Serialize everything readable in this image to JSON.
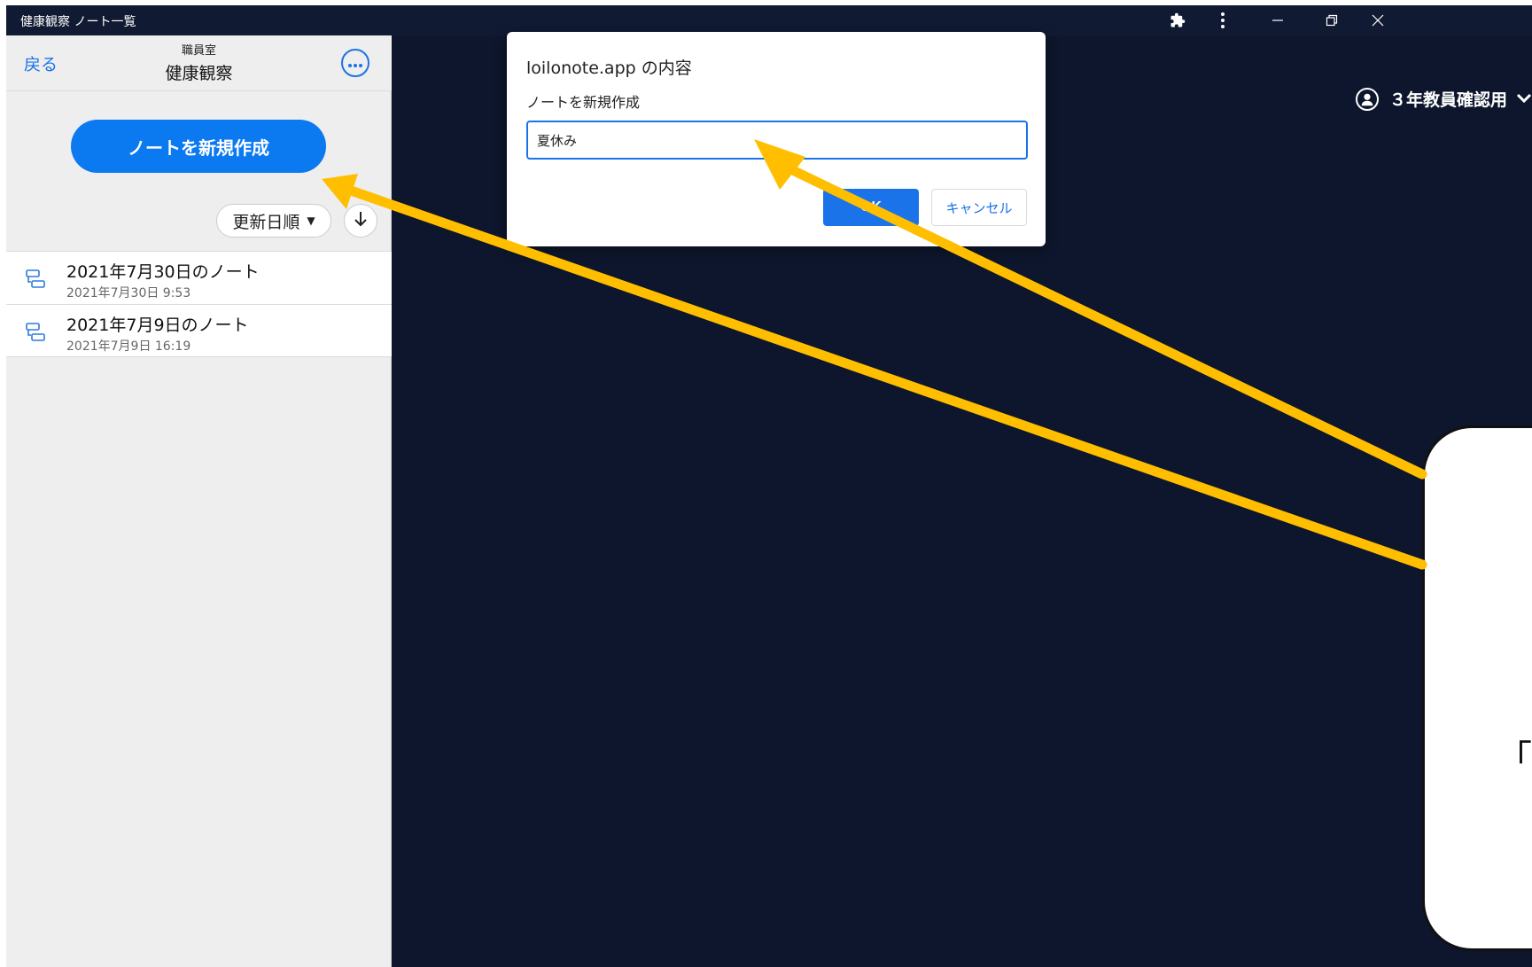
{
  "window": {
    "title": "健康観察 ノート一覧"
  },
  "sidebar": {
    "back_label": "戻る",
    "header_subtitle": "職員室",
    "header_title": "健康観察",
    "new_note_label": "ノートを新規作成",
    "sort_label": "更新日順",
    "notes": [
      {
        "title": "2021年7月30日のノート",
        "date": "2021年7月30日 9:53"
      },
      {
        "title": "2021年7月9日のノート",
        "date": "2021年7月9日 16:19"
      }
    ]
  },
  "user_menu": {
    "name": "３年教員確認用"
  },
  "dialog": {
    "title": "loilonote.app の内容",
    "message": "ノートを新規作成",
    "input_value": "夏休み",
    "ok_label": "OK",
    "cancel_label": "キャンセル"
  },
  "callout": {
    "text": "「夏"
  },
  "colors": {
    "accent": "#0b79f0",
    "main_background": "#0d162c",
    "titlebar": "#111a33",
    "arrow": "#ffbf00"
  }
}
